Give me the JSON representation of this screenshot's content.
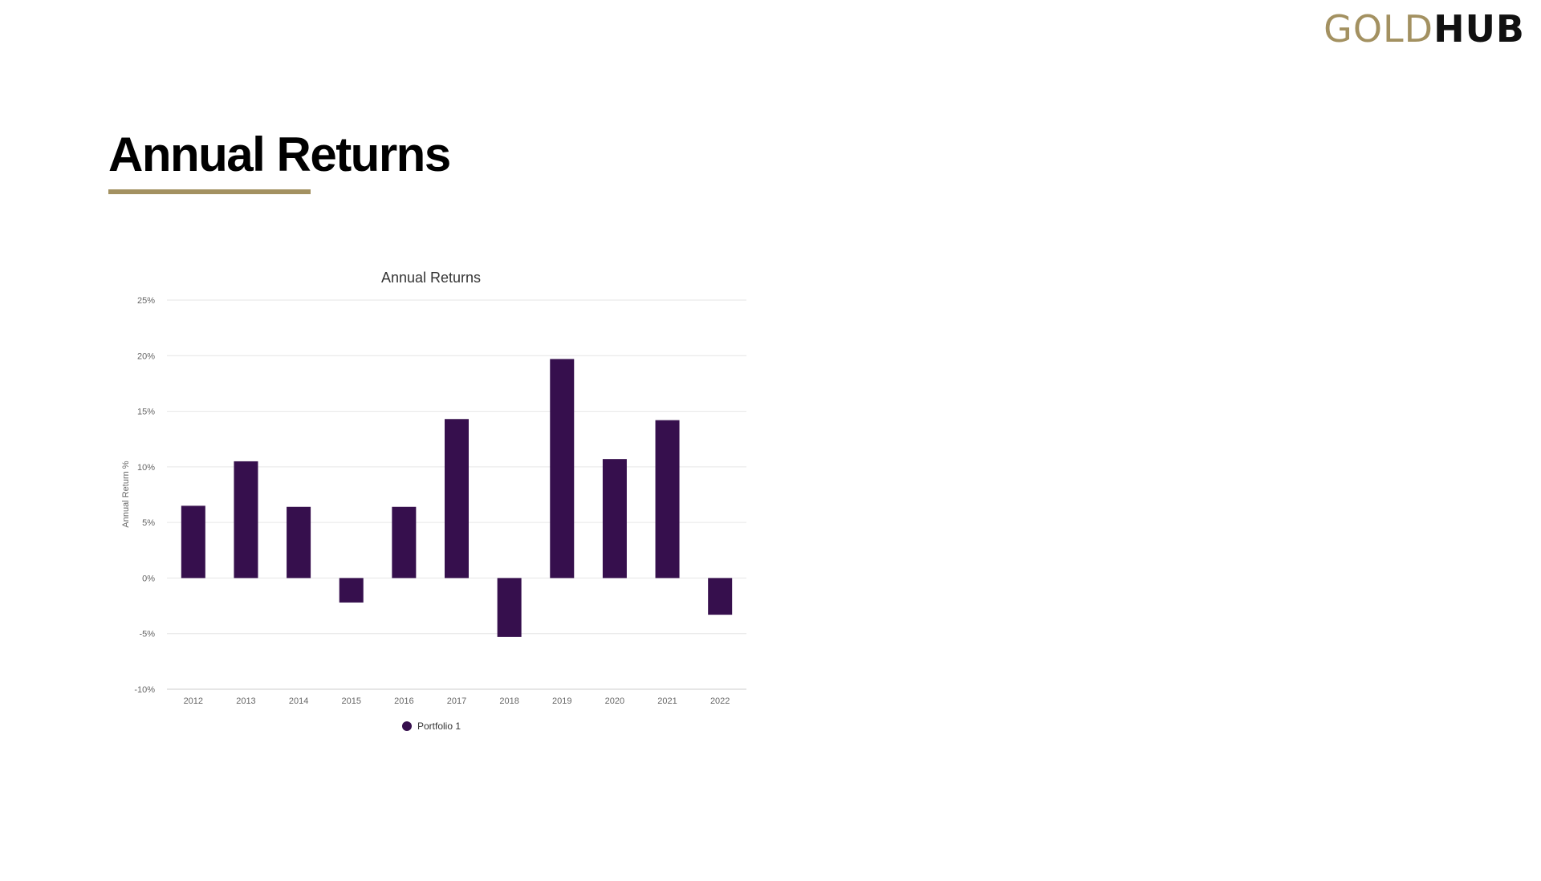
{
  "logo": {
    "part1": "GOLD",
    "part2": "HUB"
  },
  "page": {
    "title": "Annual Returns"
  },
  "colors": {
    "accent": "#a39161",
    "bar": "#360f4d",
    "grid": "#e6e6e6",
    "axis_text": "#666666"
  },
  "chart_data": {
    "type": "bar",
    "title": "Annual Returns",
    "xlabel": "",
    "ylabel": "Annual Return %",
    "categories": [
      "2012",
      "2013",
      "2014",
      "2015",
      "2016",
      "2017",
      "2018",
      "2019",
      "2020",
      "2021",
      "2022"
    ],
    "series": [
      {
        "name": "Portfolio 1",
        "values": [
          6.5,
          10.5,
          6.4,
          -2.2,
          6.4,
          14.3,
          -5.3,
          19.7,
          10.7,
          14.2,
          -3.3
        ]
      }
    ],
    "ylim": [
      -10,
      25
    ],
    "yticks": [
      -10,
      -5,
      0,
      5,
      10,
      15,
      20,
      25
    ],
    "ytick_labels": [
      "-10%",
      "-5%",
      "0%",
      "5%",
      "10%",
      "15%",
      "20%",
      "25%"
    ],
    "grid": true,
    "legend": "bottom-center"
  }
}
